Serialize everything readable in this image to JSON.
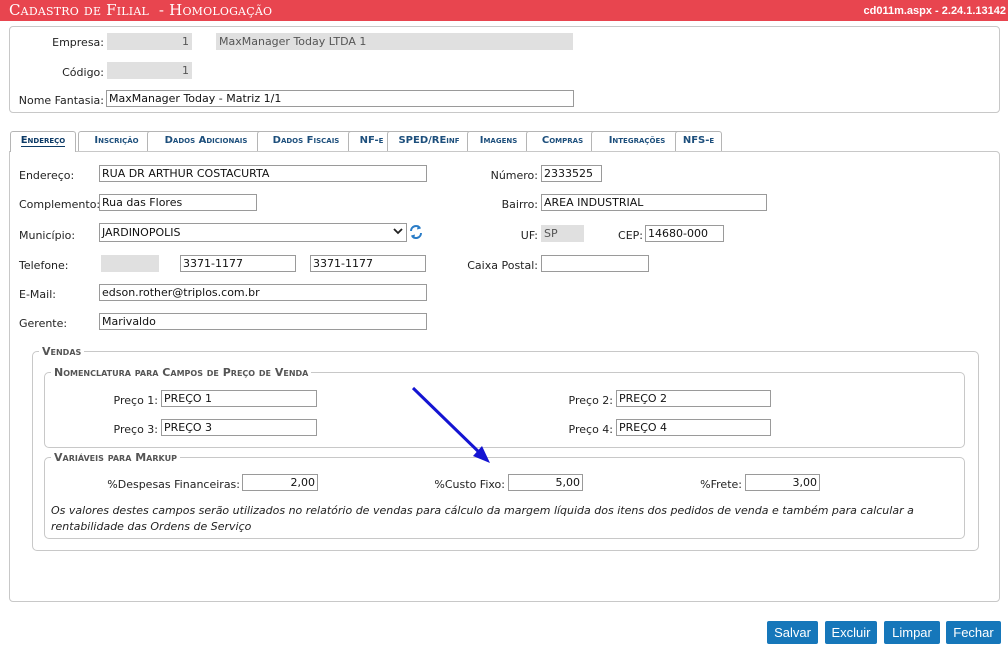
{
  "window": {
    "title": "Cadastro de Filial  - Homologação",
    "version": "cd011m.aspx - 2.24.1.13142"
  },
  "header": {
    "empresa_label": "Empresa:",
    "empresa_code": "1",
    "empresa_name": "MaxManager Today LTDA 1",
    "codigo_label": "Código:",
    "codigo_value": "1",
    "nome_fantasia_label": "Nome Fantasia:",
    "nome_fantasia_value": "MaxManager Today - Matriz 1/1"
  },
  "tabs": [
    {
      "label": "Endereço",
      "active": true
    },
    {
      "label": "Inscrição"
    },
    {
      "label": "Dados Adicionais"
    },
    {
      "label": "Dados Fiscais"
    },
    {
      "label": "NF-e"
    },
    {
      "label": "SPED/REinf"
    },
    {
      "label": "Imagens"
    },
    {
      "label": "Compras"
    },
    {
      "label": "Integrações"
    },
    {
      "label": "NFS-e"
    }
  ],
  "address": {
    "endereco_label": "Endereço:",
    "endereco_value": "RUA DR ARTHUR COSTACURTA",
    "numero_label": "Número:",
    "numero_value": "2333525",
    "complemento_label": "Complemento:",
    "complemento_value": "Rua das Flores",
    "bairro_label": "Bairro:",
    "bairro_value": "AREA INDUSTRIAL",
    "municipio_label": "Município:",
    "municipio_value": "JARDINOPOLIS",
    "uf_label": "UF:",
    "uf_value": "SP",
    "cep_label": "CEP:",
    "cep_value": "14680-000",
    "telefone_label": "Telefone:",
    "telefone_ddd": "",
    "telefone_1": "3371-1177",
    "telefone_2": "3371-1177",
    "caixa_postal_label": "Caixa Postal:",
    "caixa_postal_value": "",
    "email_label": "E-Mail:",
    "email_value": "edson.rother@triplos.com.br",
    "gerente_label": "Gerente:",
    "gerente_value": "Marivaldo"
  },
  "vendas": {
    "legend": "Vendas",
    "nomenclatura_legend": "Nomenclatura para Campos de Preço de Venda",
    "preco1_label": "Preço 1:",
    "preco1_value": "PREÇO 1",
    "preco2_label": "Preço 2:",
    "preco2_value": "PREÇO 2",
    "preco3_label": "Preço 3:",
    "preco3_value": "PREÇO 3",
    "preco4_label": "Preço 4:",
    "preco4_value": "PREÇO 4",
    "markup_legend": "Variáveis para Markup",
    "despesas_label": "%Despesas Financeiras:",
    "despesas_value": "2,00",
    "custo_fixo_label": "%Custo Fixo:",
    "custo_fixo_value": "5,00",
    "frete_label": "%Frete:",
    "frete_value": "3,00",
    "note": "Os valores destes campos serão utilizados no relatório de vendas para cálculo da margem líquida dos itens dos pedidos de venda e também para calcular a rentabilidade das Ordens de Serviço"
  },
  "buttons": {
    "salvar": "Salvar",
    "excluir": "Excluir",
    "limpar": "Limpar",
    "fechar": "Fechar"
  },
  "colors": {
    "title_bar": "#e8454f",
    "button": "#1677ba",
    "annotation_arrow": "#1414d2"
  },
  "icons": {
    "refresh": "refresh-icon",
    "dropdown": "chevron-down-icon"
  }
}
